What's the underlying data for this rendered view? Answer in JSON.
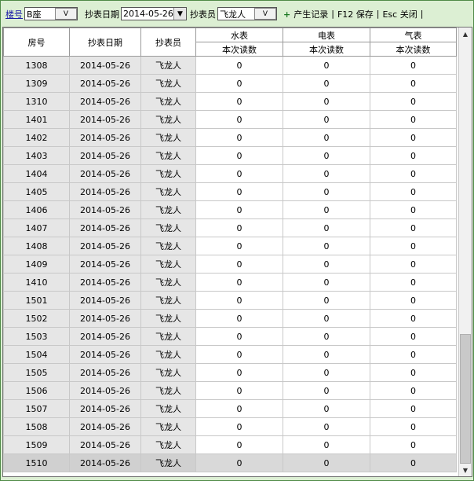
{
  "toolbar": {
    "building_label": "楼号",
    "building_value": "B座",
    "date_label": "抄表日期",
    "date_value": "2014-05-26",
    "reader_label": "抄表员",
    "reader_value": "飞龙人",
    "dropdown_glyph": "V",
    "generate_plus": "+",
    "generate_label": "产生记录",
    "save_label": "F12 保存",
    "close_label": "Esc 关闭",
    "sep": "|"
  },
  "table": {
    "headers": {
      "room": "房号",
      "date": "抄表日期",
      "reader": "抄表员",
      "water": "水表",
      "electric": "电表",
      "gas": "气表",
      "water_sub": "本次读数",
      "electric_sub": "本次读数",
      "gas_sub": "本次读数"
    },
    "rows": [
      {
        "room": "1308",
        "date": "2014-05-26",
        "reader": "飞龙人",
        "water": "0",
        "electric": "0",
        "gas": "0"
      },
      {
        "room": "1309",
        "date": "2014-05-26",
        "reader": "飞龙人",
        "water": "0",
        "electric": "0",
        "gas": "0"
      },
      {
        "room": "1310",
        "date": "2014-05-26",
        "reader": "飞龙人",
        "water": "0",
        "electric": "0",
        "gas": "0"
      },
      {
        "room": "1401",
        "date": "2014-05-26",
        "reader": "飞龙人",
        "water": "0",
        "electric": "0",
        "gas": "0"
      },
      {
        "room": "1402",
        "date": "2014-05-26",
        "reader": "飞龙人",
        "water": "0",
        "electric": "0",
        "gas": "0"
      },
      {
        "room": "1403",
        "date": "2014-05-26",
        "reader": "飞龙人",
        "water": "0",
        "electric": "0",
        "gas": "0"
      },
      {
        "room": "1404",
        "date": "2014-05-26",
        "reader": "飞龙人",
        "water": "0",
        "electric": "0",
        "gas": "0"
      },
      {
        "room": "1405",
        "date": "2014-05-26",
        "reader": "飞龙人",
        "water": "0",
        "electric": "0",
        "gas": "0"
      },
      {
        "room": "1406",
        "date": "2014-05-26",
        "reader": "飞龙人",
        "water": "0",
        "electric": "0",
        "gas": "0"
      },
      {
        "room": "1407",
        "date": "2014-05-26",
        "reader": "飞龙人",
        "water": "0",
        "electric": "0",
        "gas": "0"
      },
      {
        "room": "1408",
        "date": "2014-05-26",
        "reader": "飞龙人",
        "water": "0",
        "electric": "0",
        "gas": "0"
      },
      {
        "room": "1409",
        "date": "2014-05-26",
        "reader": "飞龙人",
        "water": "0",
        "electric": "0",
        "gas": "0"
      },
      {
        "room": "1410",
        "date": "2014-05-26",
        "reader": "飞龙人",
        "water": "0",
        "electric": "0",
        "gas": "0"
      },
      {
        "room": "1501",
        "date": "2014-05-26",
        "reader": "飞龙人",
        "water": "0",
        "electric": "0",
        "gas": "0"
      },
      {
        "room": "1502",
        "date": "2014-05-26",
        "reader": "飞龙人",
        "water": "0",
        "electric": "0",
        "gas": "0"
      },
      {
        "room": "1503",
        "date": "2014-05-26",
        "reader": "飞龙人",
        "water": "0",
        "electric": "0",
        "gas": "0"
      },
      {
        "room": "1504",
        "date": "2014-05-26",
        "reader": "飞龙人",
        "water": "0",
        "electric": "0",
        "gas": "0"
      },
      {
        "room": "1505",
        "date": "2014-05-26",
        "reader": "飞龙人",
        "water": "0",
        "electric": "0",
        "gas": "0"
      },
      {
        "room": "1506",
        "date": "2014-05-26",
        "reader": "飞龙人",
        "water": "0",
        "electric": "0",
        "gas": "0"
      },
      {
        "room": "1507",
        "date": "2014-05-26",
        "reader": "飞龙人",
        "water": "0",
        "electric": "0",
        "gas": "0"
      },
      {
        "room": "1508",
        "date": "2014-05-26",
        "reader": "飞龙人",
        "water": "0",
        "electric": "0",
        "gas": "0"
      },
      {
        "room": "1509",
        "date": "2014-05-26",
        "reader": "飞龙人",
        "water": "0",
        "electric": "0",
        "gas": "0"
      },
      {
        "room": "1510",
        "date": "2014-05-26",
        "reader": "飞龙人",
        "water": "0",
        "electric": "0",
        "gas": "0"
      }
    ],
    "selected_row_index": 22
  },
  "scrollbar": {
    "up_glyph": "▲",
    "down_glyph": "▼",
    "position_fraction": 1.0
  }
}
